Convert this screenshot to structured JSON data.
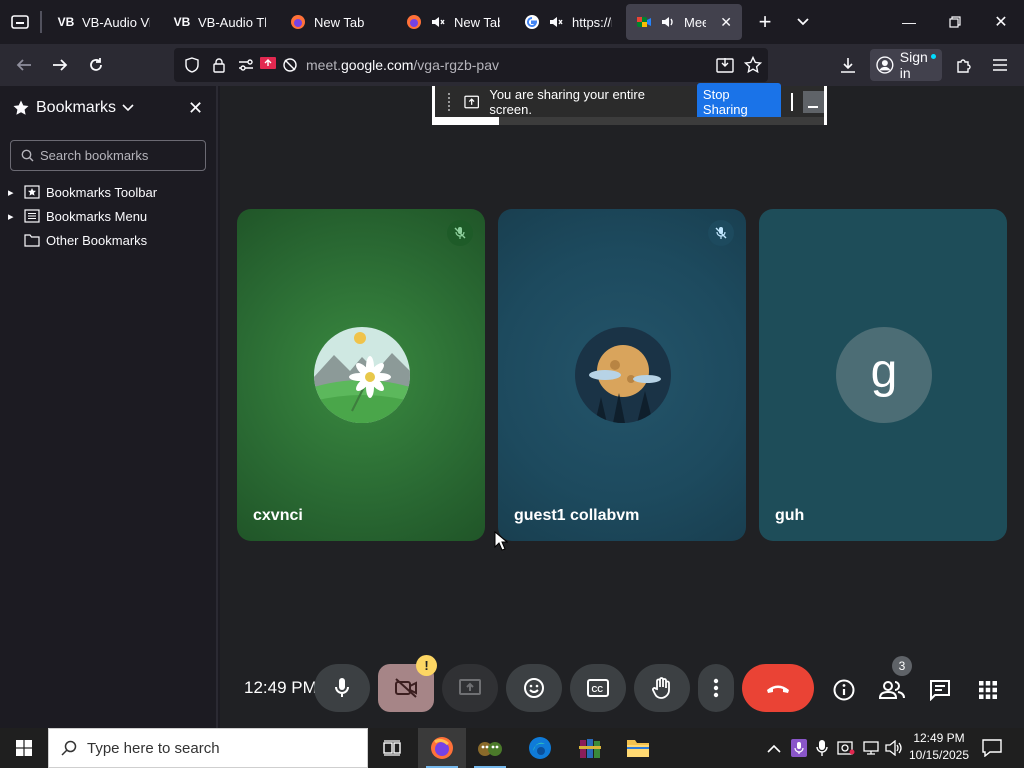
{
  "tabs": [
    {
      "title": "VB-Audio Virtu",
      "favicon": "vb-audio-logo",
      "active": false,
      "muted": false
    },
    {
      "title": "VB-Audio Thar",
      "favicon": "vb-audio-logo",
      "active": false,
      "muted": false
    },
    {
      "title": "New Tab",
      "favicon": "firefox-logo",
      "active": false,
      "muted": false
    },
    {
      "title": "New Tab",
      "favicon": "firefox-logo",
      "active": false,
      "muted": true
    },
    {
      "title": "https://me",
      "favicon": "google-logo",
      "active": false,
      "muted": true
    },
    {
      "title": "Meet - ",
      "favicon": "google-meet-logo",
      "active": true,
      "muted": false
    }
  ],
  "navbar": {
    "url_prefix": "meet.",
    "url_domain": "google.com",
    "url_path": "/vga-rgzb-pav",
    "signin_label": "Sign in"
  },
  "sidebar": {
    "title": "Bookmarks",
    "search_placeholder": "Search bookmarks",
    "items": [
      {
        "label": "Bookmarks Toolbar",
        "icon": "star-folder-icon",
        "expandable": true
      },
      {
        "label": "Bookmarks Menu",
        "icon": "list-icon",
        "expandable": true
      },
      {
        "label": "Other Bookmarks",
        "icon": "folder-icon",
        "expandable": false
      }
    ]
  },
  "share_bar": {
    "message": "You are sharing your entire screen.",
    "stop_label": "Stop Sharing"
  },
  "participants": [
    {
      "name": "cxvnci",
      "avatar": "edelweiss-mountain-image",
      "muted": true,
      "color": "#2f7a3a"
    },
    {
      "name": "guest1 collabvm",
      "avatar": "moon-night-image",
      "muted": true,
      "color": "#1f4d63"
    },
    {
      "name": "guh",
      "avatar_letter": "g",
      "muted": false,
      "color": "#1e4d59"
    }
  ],
  "controls": {
    "time": "12:49 PM",
    "people_count": "3",
    "camera_warning": "!"
  },
  "taskbar": {
    "search_placeholder": "Type here to search",
    "clock_time": "12:49 PM",
    "clock_date": "10/15/2025"
  },
  "colors": {
    "accent_blue": "#1a73e8",
    "end_call_red": "#ea4335",
    "camera_off_pink": "#a68587",
    "warning_yellow": "#fdd663"
  }
}
